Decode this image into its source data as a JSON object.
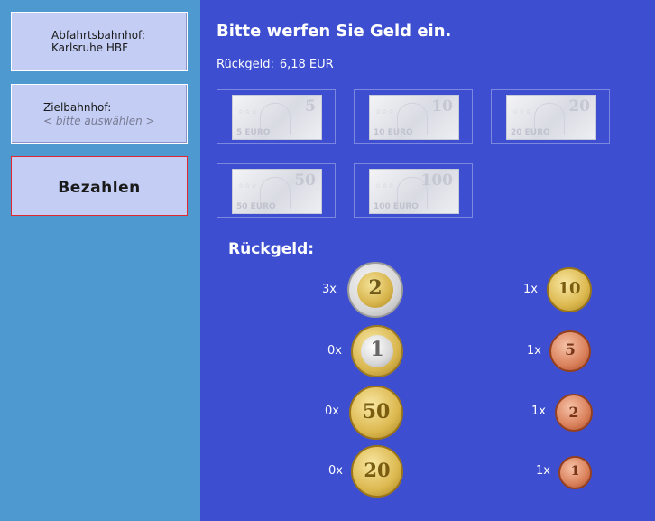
{
  "sidebar": {
    "start": {
      "title": "Abfahrtsbahnhof:",
      "value": "Karlsruhe HBF"
    },
    "destination": {
      "title": "Zielbahnhof:",
      "placeholder": "< bitte auswählen >"
    },
    "pay_label": "Bezahlen"
  },
  "main": {
    "headline": "Bitte werfen Sie Geld ein.",
    "change_label": "Rückgeld:",
    "change_value": "6,18 EUR",
    "change_heading": "Rückgeld:"
  },
  "banknotes": [
    {
      "value": "5",
      "label": "5 EURO"
    },
    {
      "value": "10",
      "label": "10 EURO"
    },
    {
      "value": "20",
      "label": "20 EURO"
    },
    {
      "value": "50",
      "label": "50 EURO"
    },
    {
      "value": "100",
      "label": "100 EURO"
    }
  ],
  "coins": {
    "left": [
      {
        "count": "3x",
        "value": "2",
        "type": "bimetal-2"
      },
      {
        "count": "0x",
        "value": "1",
        "type": "bimetal-1"
      },
      {
        "count": "0x",
        "value": "50",
        "type": "gold"
      },
      {
        "count": "0x",
        "value": "20",
        "type": "gold"
      }
    ],
    "right": [
      {
        "count": "1x",
        "value": "10",
        "type": "gold"
      },
      {
        "count": "1x",
        "value": "5",
        "type": "copper"
      },
      {
        "count": "1x",
        "value": "2",
        "type": "copper"
      },
      {
        "count": "1x",
        "value": "1",
        "type": "copper"
      }
    ]
  },
  "colors": {
    "sidebar_bg": "#4e9ad0",
    "main_bg": "#3d4fd0",
    "button_bg": "#c4cdf4",
    "pay_border": "#e0282e"
  }
}
